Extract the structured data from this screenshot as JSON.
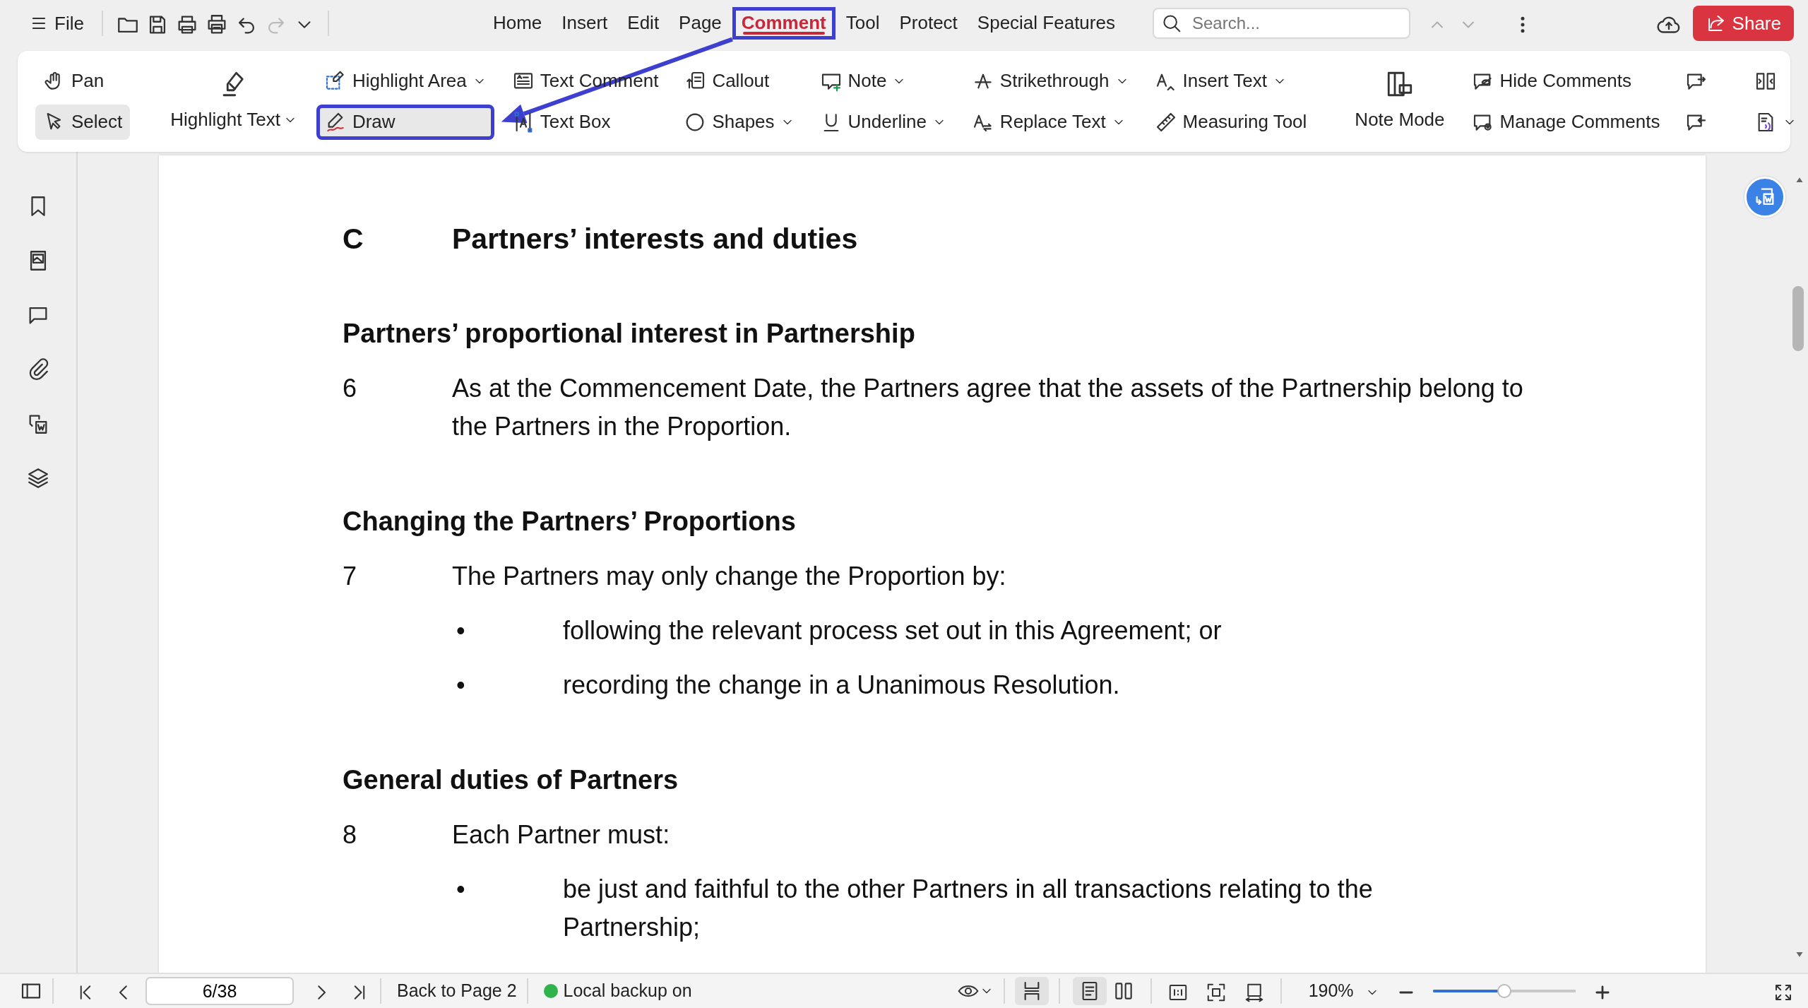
{
  "menu_button": "File",
  "quick_tools": [
    {
      "disabled": false
    },
    {
      "disabled": false
    },
    {
      "disabled": false
    },
    {
      "disabled": false
    },
    {
      "disabled": false
    },
    {
      "disabled": true
    }
  ],
  "tabs": [
    {
      "label": "Home",
      "selected": false,
      "highlighted": false
    },
    {
      "label": "Insert",
      "selected": false,
      "highlighted": false
    },
    {
      "label": "Edit",
      "selected": false,
      "highlighted": false
    },
    {
      "label": "Page",
      "selected": false,
      "highlighted": false
    },
    {
      "label": "Comment",
      "selected": true,
      "highlighted": true
    },
    {
      "label": "Tool",
      "selected": false,
      "highlighted": false
    },
    {
      "label": "Protect",
      "selected": false,
      "highlighted": false
    },
    {
      "label": "Special Features",
      "selected": false,
      "highlighted": false
    }
  ],
  "search": {
    "placeholder": "Search..."
  },
  "share_button": "Share",
  "ribbon": [
    {
      "kind": "stack",
      "items": [
        {
          "label": "Pan",
          "selected": false,
          "dropdown": false,
          "highlighted": false
        },
        {
          "label": "Select",
          "selected": true,
          "dropdown": false,
          "highlighted": false
        }
      ]
    },
    {
      "kind": "divider"
    },
    {
      "kind": "big",
      "items": [
        {
          "label": "Highlight Text",
          "selected": false,
          "dropdown": true,
          "highlighted": false
        }
      ]
    },
    {
      "kind": "stack",
      "items": [
        {
          "label": "Highlight Area",
          "selected": false,
          "dropdown": true,
          "highlighted": false
        },
        {
          "label": "Draw",
          "selected": true,
          "dropdown": false,
          "highlighted": true
        }
      ]
    },
    {
      "kind": "stack",
      "items": [
        {
          "label": "Text Comment",
          "selected": false,
          "dropdown": false,
          "highlighted": false
        },
        {
          "label": "Text Box",
          "selected": false,
          "dropdown": false,
          "highlighted": false
        }
      ]
    },
    {
      "kind": "stack",
      "items": [
        {
          "label": "Callout",
          "selected": false,
          "dropdown": false,
          "highlighted": false
        },
        {
          "label": "Shapes",
          "selected": false,
          "dropdown": true,
          "highlighted": false
        }
      ]
    },
    {
      "kind": "stack",
      "items": [
        {
          "label": "Note",
          "selected": false,
          "dropdown": true,
          "highlighted": false
        },
        {
          "label": "Underline",
          "selected": false,
          "dropdown": true,
          "highlighted": false
        }
      ]
    },
    {
      "kind": "stack",
      "items": [
        {
          "label": "Strikethrough",
          "selected": false,
          "dropdown": true,
          "highlighted": false
        },
        {
          "label": "Replace Text",
          "selected": false,
          "dropdown": true,
          "highlighted": false
        }
      ]
    },
    {
      "kind": "stack",
      "items": [
        {
          "label": "Insert Text",
          "selected": false,
          "dropdown": true,
          "highlighted": false
        },
        {
          "label": "Measuring Tool",
          "selected": false,
          "dropdown": false,
          "highlighted": false
        }
      ]
    },
    {
      "kind": "divider"
    },
    {
      "kind": "big",
      "items": [
        {
          "label": "Note Mode",
          "selected": false,
          "dropdown": false,
          "highlighted": false
        }
      ]
    },
    {
      "kind": "stack",
      "items": [
        {
          "label": "Hide Comments",
          "selected": false,
          "dropdown": false,
          "highlighted": false
        },
        {
          "label": "Manage Comments",
          "selected": false,
          "dropdown": false,
          "highlighted": false
        }
      ]
    },
    {
      "kind": "stack",
      "items": [
        {
          "selected": false,
          "dropdown": false,
          "highlighted": false
        },
        {
          "selected": false,
          "dropdown": false,
          "highlighted": false
        }
      ]
    },
    {
      "kind": "divider"
    },
    {
      "kind": "stack",
      "items": [
        {
          "selected": false,
          "dropdown": false,
          "highlighted": false
        },
        {
          "selected": false,
          "dropdown": true,
          "highlighted": false
        }
      ]
    }
  ],
  "document": [
    {
      "kind": "title",
      "number": "C",
      "text": "Partners’ interests and duties"
    },
    {
      "kind": "heading",
      "text": "Partners’ proportional interest in Partnership"
    },
    {
      "kind": "clause",
      "number": "6",
      "text": "As at the Commencement Date, the Partners agree that the assets of the Partnership belong to the Partners in the Proportion."
    },
    {
      "kind": "heading",
      "text": "Changing the Partners’ Proportions"
    },
    {
      "kind": "clause",
      "number": "7",
      "text": "The Partners may only change the Proportion by:"
    },
    {
      "kind": "bullet",
      "marker": "•",
      "text": "following the relevant process set out in this Agreement; or"
    },
    {
      "kind": "bullet",
      "marker": "•",
      "text": "recording the change in a Unanimous Resolution."
    },
    {
      "kind": "heading",
      "text": "General duties of Partners"
    },
    {
      "kind": "clause",
      "number": "8",
      "text": "Each Partner must:"
    },
    {
      "kind": "bullet",
      "marker": "•",
      "text": "be just and faithful to the other Partners in all transactions relating to the Partnership;"
    }
  ],
  "status_bar": {
    "page_field": "6/38",
    "back_link": "Back to Page 2",
    "backup": {
      "label": "Local backup on",
      "on": true
    },
    "layout_buttons": [
      {
        "selected": true
      },
      {
        "selected": true
      },
      {
        "selected": false
      }
    ],
    "zoom": {
      "value": "190%",
      "level": 0.5
    }
  }
}
